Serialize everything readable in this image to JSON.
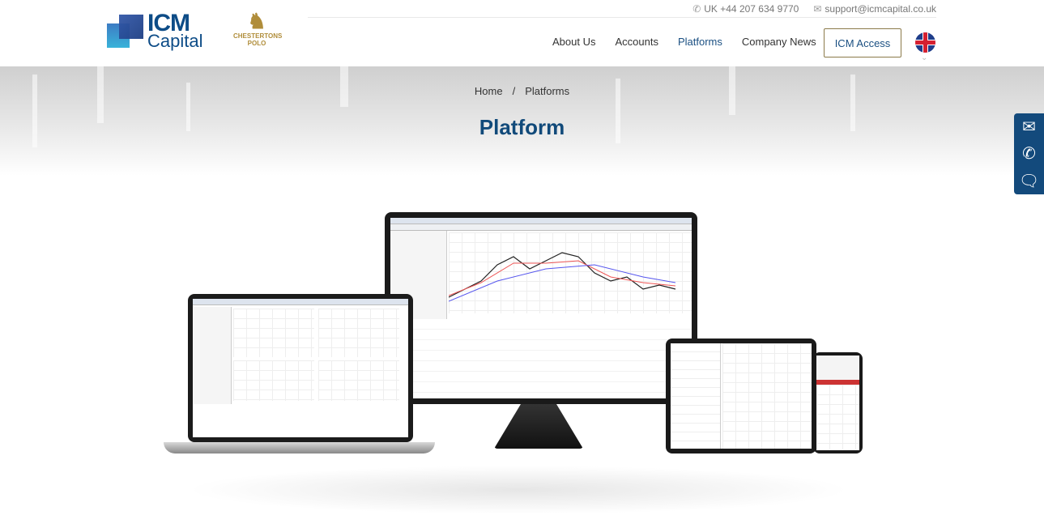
{
  "topbar": {
    "phone": "UK +44 207 634 9770",
    "email": "support@icmcapital.co.uk"
  },
  "logo": {
    "line1": "ICM",
    "line2": "Capital",
    "partner": "CHESTERTONS POLO"
  },
  "nav": {
    "items": [
      {
        "label": "About Us"
      },
      {
        "label": "Accounts"
      },
      {
        "label": "Platforms",
        "active": true
      },
      {
        "label": "Company News"
      }
    ],
    "cta": "ICM Access",
    "language": "UK flag"
  },
  "breadcrumb": {
    "home": "Home",
    "separator": "/",
    "current": "Platforms"
  },
  "page_title": "Platform",
  "sidebar_contact": [
    "envelope-icon",
    "phone-icon",
    "chat-icon"
  ],
  "colors": {
    "brand": "#114a7a",
    "accent_gold": "#8b7a4a"
  }
}
